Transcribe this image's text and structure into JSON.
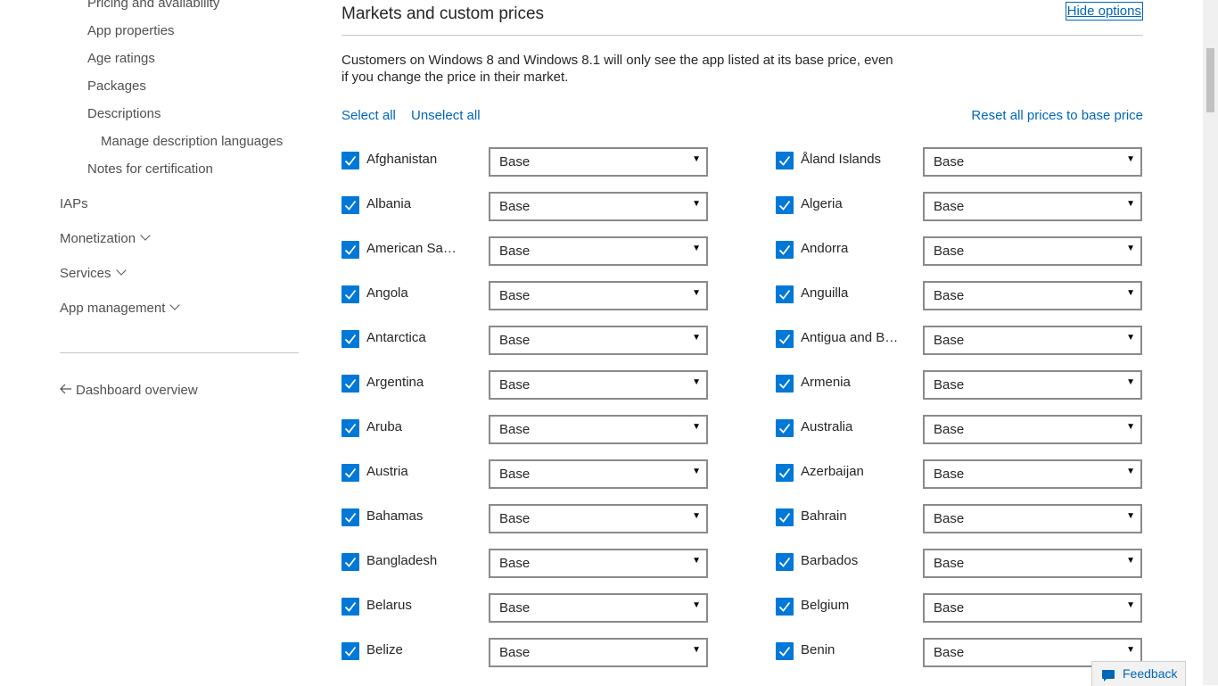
{
  "sidebar": {
    "submission_items": [
      "Pricing and availability",
      "App properties",
      "Age ratings",
      "Packages",
      "Descriptions",
      "Manage description languages",
      "Notes for certification"
    ],
    "sections": [
      {
        "label": "IAPs",
        "expandable": false
      },
      {
        "label": "Monetization",
        "expandable": true
      },
      {
        "label": "Services",
        "expandable": true
      },
      {
        "label": "App management",
        "expandable": true
      }
    ],
    "back_link": "Dashboard overview"
  },
  "main": {
    "title": "Markets and custom prices",
    "hide_options": "Hide options",
    "note": "Customers on Windows 8 and Windows 8.1 will only see the app listed at its base price, even if you change the price in their market.",
    "select_all": "Select all",
    "unselect_all": "Unselect all",
    "reset_prices": "Reset all prices to base price",
    "markets_left": [
      {
        "name": "Afghanistan",
        "price": "Base",
        "checked": true
      },
      {
        "name": "Albania",
        "price": "Base",
        "checked": true
      },
      {
        "name": "American Sam...",
        "price": "Base",
        "checked": true
      },
      {
        "name": "Angola",
        "price": "Base",
        "checked": true
      },
      {
        "name": "Antarctica",
        "price": "Base",
        "checked": true
      },
      {
        "name": "Argentina",
        "price": "Base",
        "checked": true
      },
      {
        "name": "Aruba",
        "price": "Base",
        "checked": true
      },
      {
        "name": "Austria",
        "price": "Base",
        "checked": true
      },
      {
        "name": "Bahamas",
        "price": "Base",
        "checked": true
      },
      {
        "name": "Bangladesh",
        "price": "Base",
        "checked": true
      },
      {
        "name": "Belarus",
        "price": "Base",
        "checked": true
      },
      {
        "name": "Belize",
        "price": "Base",
        "checked": true
      }
    ],
    "markets_right": [
      {
        "name": "Åland Islands",
        "price": "Base",
        "checked": true
      },
      {
        "name": "Algeria",
        "price": "Base",
        "checked": true
      },
      {
        "name": "Andorra",
        "price": "Base",
        "checked": true
      },
      {
        "name": "Anguilla",
        "price": "Base",
        "checked": true
      },
      {
        "name": "Antigua and Ba...",
        "price": "Base",
        "checked": true
      },
      {
        "name": "Armenia",
        "price": "Base",
        "checked": true
      },
      {
        "name": "Australia",
        "price": "Base",
        "checked": true
      },
      {
        "name": "Azerbaijan",
        "price": "Base",
        "checked": true
      },
      {
        "name": "Bahrain",
        "price": "Base",
        "checked": true
      },
      {
        "name": "Barbados",
        "price": "Base",
        "checked": true
      },
      {
        "name": "Belgium",
        "price": "Base",
        "checked": true
      },
      {
        "name": "Benin",
        "price": "Base",
        "checked": true
      }
    ],
    "dropdown_arrow": "▼"
  },
  "feedback": {
    "label": "Feedback",
    "icon": "chat-bubble-icon"
  },
  "colors": {
    "accent": "#0078d7",
    "link": "#0067b8",
    "border": "#8a8a8a"
  }
}
